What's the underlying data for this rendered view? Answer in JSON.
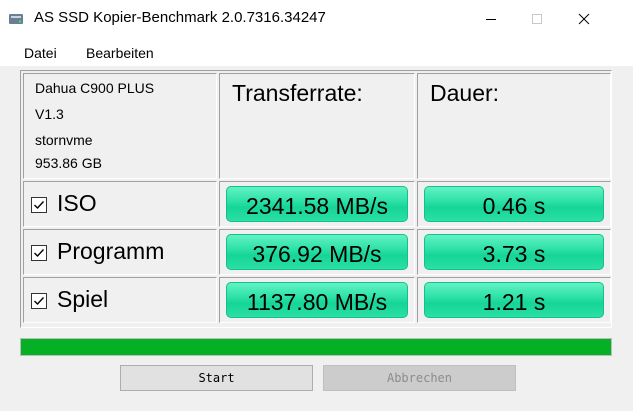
{
  "window": {
    "title": "AS SSD Kopier-Benchmark 2.0.7316.34247",
    "app_icon": "disk-benchmark-icon",
    "controls": [
      "minimize-icon",
      "maximize-icon",
      "close-icon"
    ]
  },
  "menu": {
    "items": [
      {
        "label": "Datei"
      },
      {
        "label": "Bearbeiten"
      }
    ]
  },
  "drive": {
    "model": "Dahua C900 PLUS",
    "firmware": "V1.3",
    "driver": "stornvme",
    "capacity": "953.86 GB"
  },
  "columns": {
    "transfer": "Transferrate:",
    "duration": "Dauer:"
  },
  "rows": [
    {
      "label": "ISO",
      "checked": true,
      "transfer": "2341.58 MB/s",
      "duration": "0.46 s"
    },
    {
      "label": "Programm",
      "checked": true,
      "transfer": "376.92 MB/s",
      "duration": "3.73 s"
    },
    {
      "label": "Spiel",
      "checked": true,
      "transfer": "1137.80 MB/s",
      "duration": "1.21 s"
    }
  ],
  "progress": {
    "percent": 100,
    "color": "#06b025"
  },
  "buttons": {
    "start": "Start",
    "abort": "Abbrechen",
    "abort_enabled": false
  },
  "colors": {
    "result_fill": "#2ee2a8",
    "progress": "#06b025"
  }
}
